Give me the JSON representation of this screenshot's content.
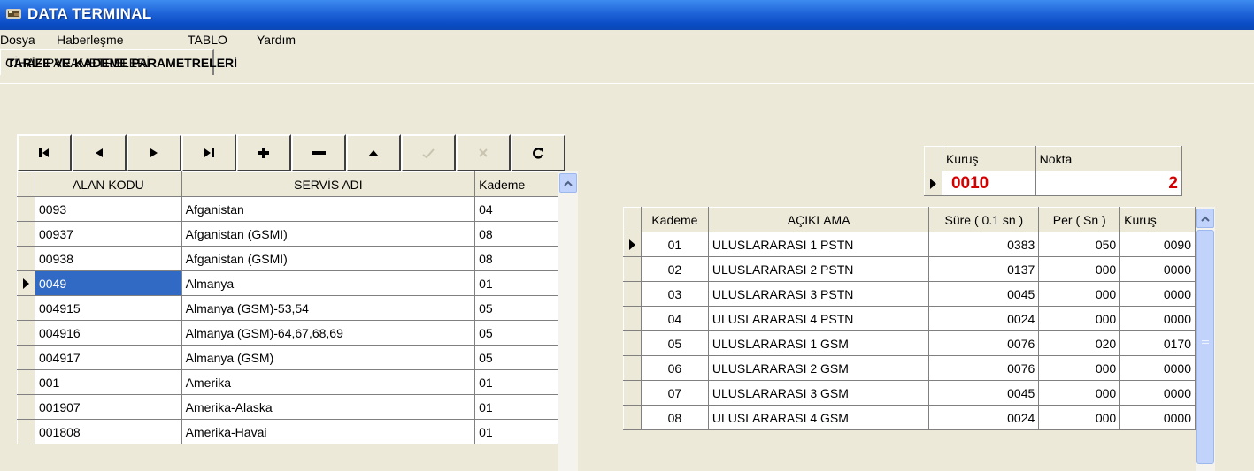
{
  "window": {
    "title": "DATA TERMINAL"
  },
  "menu": [
    {
      "label": "Dosya"
    },
    {
      "label": "Haberleşme"
    },
    {
      "label": "TABLO"
    },
    {
      "label": "Yardım"
    }
  ],
  "tabs": [
    {
      "label": "TARİFE VE KADEME PARAMETRELERİ",
      "active": true
    },
    {
      "label": "CİHAZ PARAMETRELERİ",
      "active": false
    }
  ],
  "navigator": [
    {
      "name": "first-record",
      "icon": "first-icon",
      "enabled": true
    },
    {
      "name": "prior-record",
      "icon": "prior-icon",
      "enabled": true
    },
    {
      "name": "next-record",
      "icon": "next-icon",
      "enabled": true
    },
    {
      "name": "last-record",
      "icon": "last-icon",
      "enabled": true
    },
    {
      "name": "insert-record",
      "icon": "plus-icon",
      "enabled": true
    },
    {
      "name": "delete-record",
      "icon": "minus-icon",
      "enabled": true
    },
    {
      "name": "edit-record",
      "icon": "up-triangle-icon",
      "enabled": true
    },
    {
      "name": "post-record",
      "icon": "check-icon",
      "enabled": false
    },
    {
      "name": "cancel-record",
      "icon": "cancel-x-icon",
      "enabled": false
    },
    {
      "name": "refresh-record",
      "icon": "refresh-icon",
      "enabled": true
    }
  ],
  "left_grid": {
    "headers": [
      "ALAN KODU",
      "SERVİS ADI",
      "Kademe"
    ],
    "rows": [
      {
        "code": "0093",
        "name": "Afganistan",
        "level": "04"
      },
      {
        "code": "00937",
        "name": "Afganistan (GSMI)",
        "level": "08"
      },
      {
        "code": "00938",
        "name": "Afganistan (GSMI)",
        "level": "08"
      },
      {
        "code": "0049",
        "name": "Almanya",
        "level": "01"
      },
      {
        "code": "004915",
        "name": "Almanya (GSM)-53,54",
        "level": "05"
      },
      {
        "code": "004916",
        "name": "Almanya (GSM)-64,67,68,69",
        "level": "05"
      },
      {
        "code": "004917",
        "name": "Almanya (GSM)",
        "level": "05"
      },
      {
        "code": "001",
        "name": "Amerika",
        "level": "01"
      },
      {
        "code": "001907",
        "name": "Amerika-Alaska",
        "level": "01"
      },
      {
        "code": "001808",
        "name": "Amerika-Havai",
        "level": "01"
      }
    ],
    "selected_index": 3
  },
  "kurus_nokta": {
    "headers": [
      "Kuruş",
      "Nokta"
    ],
    "kurus": "0010",
    "nokta": "2",
    "value_color": "#d40000"
  },
  "right_grid": {
    "headers": [
      "Kademe",
      "AÇIKLAMA",
      "Süre ( 0.1 sn )",
      "Per ( Sn )",
      "Kuruş"
    ],
    "rows": [
      {
        "kademe": "01",
        "aciklama": "ULUSLARARASI 1 PSTN",
        "sure": "0383",
        "per": "050",
        "kurus": "0090"
      },
      {
        "kademe": "02",
        "aciklama": "ULUSLARARASI 2 PSTN",
        "sure": "0137",
        "per": "000",
        "kurus": "0000"
      },
      {
        "kademe": "03",
        "aciklama": "ULUSLARARASI 3 PSTN",
        "sure": "0045",
        "per": "000",
        "kurus": "0000"
      },
      {
        "kademe": "04",
        "aciklama": "ULUSLARARASI 4 PSTN",
        "sure": "0024",
        "per": "000",
        "kurus": "0000"
      },
      {
        "kademe": "05",
        "aciklama": "ULUSLARARASI 1 GSM",
        "sure": "0076",
        "per": "020",
        "kurus": "0170"
      },
      {
        "kademe": "06",
        "aciklama": "ULUSLARARASI 2 GSM",
        "sure": "0076",
        "per": "000",
        "kurus": "0000"
      },
      {
        "kademe": "07",
        "aciklama": "ULUSLARARASI 3 GSM",
        "sure": "0045",
        "per": "000",
        "kurus": "0000"
      },
      {
        "kademe": "08",
        "aciklama": "ULUSLARARASI 4 GSM",
        "sure": "0024",
        "per": "000",
        "kurus": "0000"
      }
    ],
    "current_index": 0
  },
  "colors": {
    "title_bar": "#0a4cc4",
    "selection": "#316ac5",
    "face": "#ece9d8",
    "scroll": "#c1d3fb"
  }
}
